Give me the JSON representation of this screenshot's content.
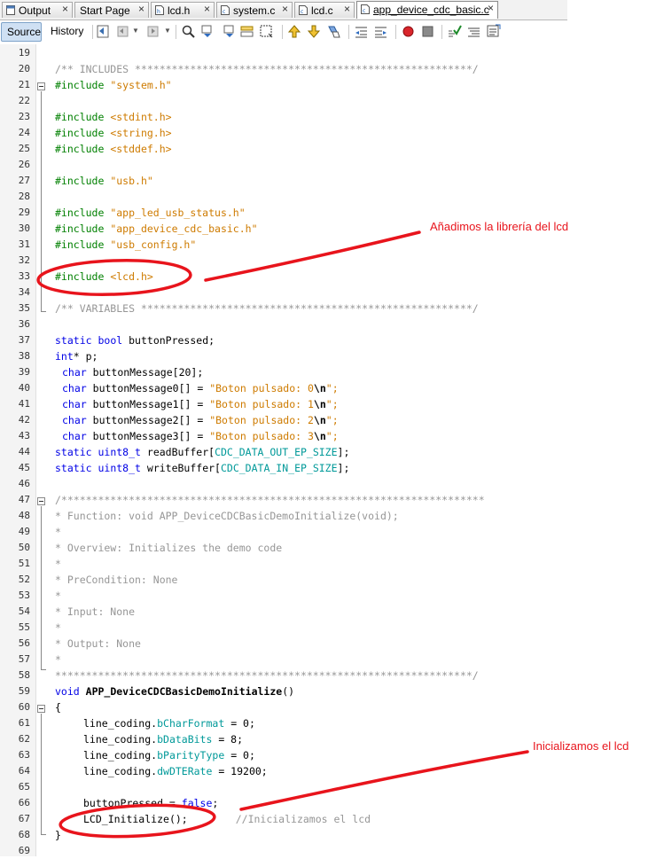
{
  "tabs": [
    {
      "label": "Output",
      "icon": "output-window-icon",
      "active": false
    },
    {
      "label": "Start Page",
      "icon": "",
      "active": false
    },
    {
      "label": "lcd.h",
      "icon": "header-file-icon",
      "active": false
    },
    {
      "label": "system.c",
      "icon": "c-file-icon",
      "active": false
    },
    {
      "label": "lcd.c",
      "icon": "c-file-icon",
      "active": false
    },
    {
      "label": "app_device_cdc_basic.c",
      "icon": "c-file-icon",
      "active": true
    }
  ],
  "tab_close_glyph": "×",
  "toolbar": {
    "source_label": "Source",
    "history_label": "History"
  },
  "gutter": {
    "line_numbers": [
      "19",
      "20",
      "21",
      "22",
      "23",
      "24",
      "25",
      "26",
      "27",
      "28",
      "29",
      "30",
      "31",
      "32",
      "33",
      "34",
      "35",
      "36",
      "37",
      "38",
      "39",
      "40",
      "41",
      "42",
      "43",
      "44",
      "45",
      "46",
      "47",
      "48",
      "49",
      "50",
      "51",
      "52",
      "53",
      "54",
      "55",
      "56",
      "57",
      "58",
      "59",
      "60",
      "61",
      "62",
      "63",
      "64",
      "65",
      "66",
      "67",
      "68",
      "69"
    ]
  },
  "code": {
    "l19": "",
    "l20": "/** INCLUDES *******************************************************/",
    "l21_kw": "#include",
    "l21_s": "\"system.h\"",
    "l23_kw": "#include",
    "l23_s": "<stdint.h>",
    "l24_kw": "#include",
    "l24_s": "<string.h>",
    "l25_kw": "#include",
    "l25_s": "<stddef.h>",
    "l27_kw": "#include",
    "l27_s": "\"usb.h\"",
    "l29_kw": "#include",
    "l29_s": "\"app_led_usb_status.h\"",
    "l30_kw": "#include",
    "l30_s": "\"app_device_cdc_basic.h\"",
    "l31_kw": "#include",
    "l31_s": "\"usb_config.h\"",
    "l33_kw": "#include",
    "l33_s": "<lcd.h>",
    "l35": "/** VARIABLES ******************************************************/",
    "l37_k1": "static",
    "l37_k2": "bool",
    "l37_rest": "buttonPressed;",
    "l38_k": "int",
    "l38_rest": "* p;",
    "l39_k": "char",
    "l39_rest": "buttonMessage[20];",
    "l40_k": "char",
    "l40_rest": "buttonMessage0[] = ",
    "l40_s": "\"Boton pulsado: 0",
    "l41_k": "char",
    "l41_rest": "buttonMessage1[] = ",
    "l41_s": "\"Boton pulsado: 1",
    "l42_k": "char",
    "l42_rest": "buttonMessage2[] = ",
    "l42_s": "\"Boton pulsado: 2",
    "l43_k": "char",
    "l43_rest": "buttonMessage3[] = ",
    "l43_s": "\"Boton pulsado: 3",
    "esc": "\\n",
    "str_end": "\";",
    "l44_k1": "static",
    "l44_k2": "uint8_t",
    "l44_rest": "readBuffer[",
    "l44_f": "CDC_DATA_OUT_EP_SIZE",
    "l45_k1": "static",
    "l45_k2": "uint8_t",
    "l45_rest": "writeBuffer[",
    "l45_f": "CDC_DATA_IN_EP_SIZE",
    "close_br": "];",
    "l47": "/*********************************************************************",
    "l48": "* Function: void APP_DeviceCDCBasicDemoInitialize(void);",
    "l49": "*",
    "l50": "* Overview: Initializes the demo code",
    "l51": "*",
    "l52": "* PreCondition: None",
    "l53": "*",
    "l54": "* Input: None",
    "l55": "*",
    "l56": "* Output: None",
    "l57": "*",
    "l58": "********************************************************************/",
    "l59_k": "void",
    "l59_rest": "APP_DeviceCDCBasicDemoInitialize",
    "l59_end": "()",
    "l60": "{",
    "l61_a": "line_coding.",
    "l61_f": "bCharFormat",
    "l61_b": " = 0;",
    "l62_a": "line_coding.",
    "l62_f": "bDataBits",
    "l62_b": " = 8;",
    "l63_a": "line_coding.",
    "l63_f": "bParityType",
    "l63_b": " = 0;",
    "l64_a": "line_coding.",
    "l64_f": "dwDTERate",
    "l64_b": " = 19200;",
    "l66_a": "buttonPressed = ",
    "l66_k": "false",
    "l66_b": ";",
    "l67_a": "LCD_Initialize",
    "l67_b": "();",
    "l67_c": "//Inicializamos el lcd",
    "l68": "}"
  },
  "annotations": {
    "include_note": "Añadimos la librería del lcd",
    "init_note": "Inicializamos el lcd"
  },
  "colors": {
    "keyword": "#0000e6",
    "preprocessor": "#008000",
    "string": "#ce7b00",
    "comment": "#969696",
    "field": "#009999",
    "annotation": "#e8141c"
  }
}
